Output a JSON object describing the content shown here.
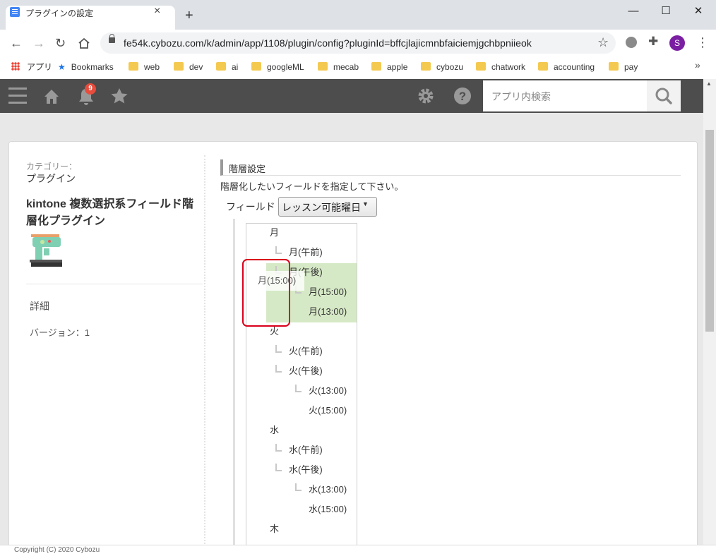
{
  "browser": {
    "tab_title": "プラグインの設定",
    "tab_close": "×",
    "new_tab": "+",
    "window_minimize": "—",
    "window_maximize": "☐",
    "window_close": "✕",
    "url": "fe54k.cybozu.com/k/admin/app/1108/plugin/config?pluginId=bffcjlajicmnbfaiciemjgchbpniieok",
    "profile_initial": "S",
    "bookmarks": [
      "アプリ",
      "Bookmarks",
      "web",
      "dev",
      "ai",
      "googleML",
      "mecab",
      "apple",
      "cybozu",
      "chatwork",
      "accounting",
      "pay"
    ],
    "bookmarks_more": "»"
  },
  "header": {
    "notification_count": "9",
    "search_placeholder": "アプリ内検索"
  },
  "sidebar": {
    "category_label": "カテゴリー：",
    "category_value": "プラグイン",
    "plugin_name": "kintone 複数選択系フィールド階層化プラグイン",
    "detail_link": "詳細",
    "version": "バージョン：1"
  },
  "config": {
    "section_title": "階層設定",
    "description": "階層化したいフィールドを指定して下さい。",
    "field_label": "フィールド",
    "field_value": "レッスン可能曜日",
    "tree": [
      {
        "label": "月",
        "level": 0
      },
      {
        "label": "月(午前)",
        "level": 1
      },
      {
        "label": "月(午後)",
        "level": 1
      },
      {
        "label": "月(15:00)",
        "level": 2
      },
      {
        "label": "月(13:00)",
        "level": 3
      },
      {
        "label": "火",
        "level": 0
      },
      {
        "label": "火(午前)",
        "level": 1
      },
      {
        "label": "火(午後)",
        "level": 1
      },
      {
        "label": "火(13:00)",
        "level": 2
      },
      {
        "label": "火(15:00)",
        "level": 3
      },
      {
        "label": "水",
        "level": 0
      },
      {
        "label": "水(午前)",
        "level": 1
      },
      {
        "label": "水(午後)",
        "level": 1
      },
      {
        "label": "水(13:00)",
        "level": 2
      },
      {
        "label": "水(15:00)",
        "level": 3
      },
      {
        "label": "木",
        "level": 0
      }
    ],
    "drag_ghost_label": "月(15:00)"
  },
  "footer": {
    "copyright": "Copyright (C) 2020 Cybozu"
  }
}
